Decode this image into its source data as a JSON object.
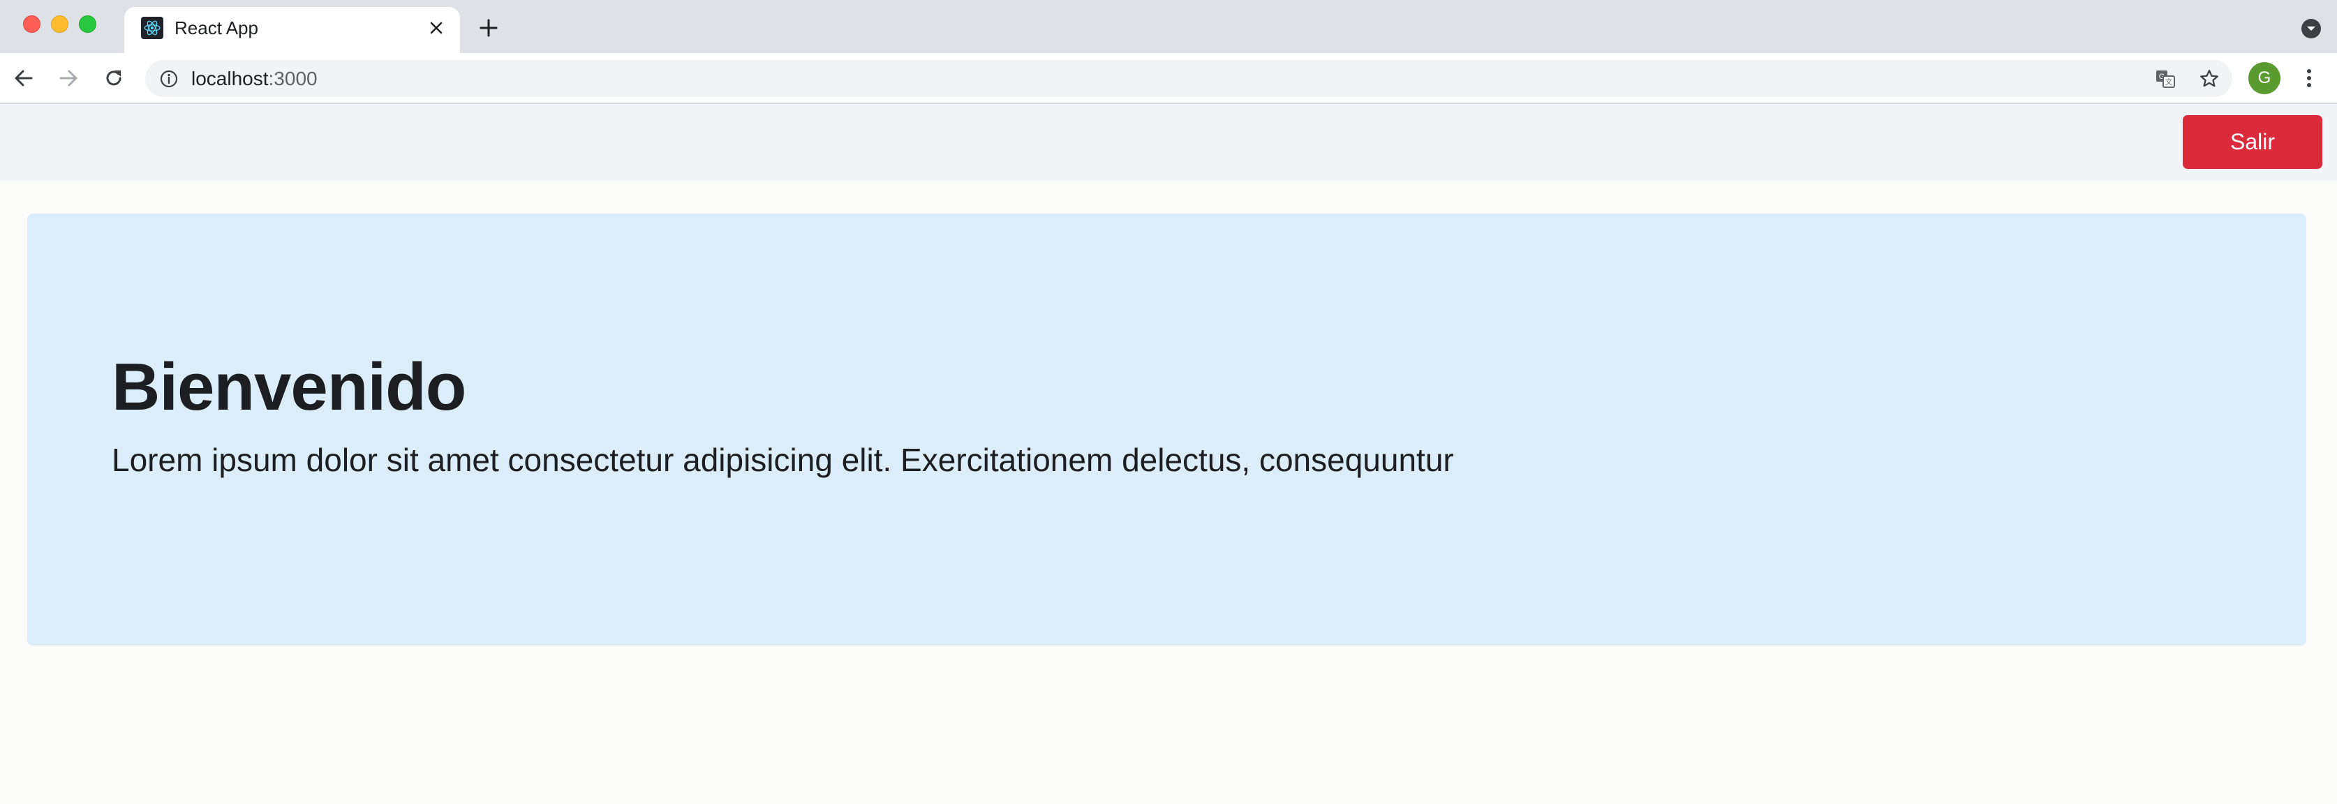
{
  "browser": {
    "tab": {
      "title": "React App",
      "favicon": "react-logo-icon"
    },
    "address_bar": {
      "host": "localhost",
      "port": ":3000"
    },
    "profile_initial": "G",
    "colors": {
      "tabstrip": "#dee1e6",
      "avatar": "#5b9a2f"
    }
  },
  "navbar": {
    "logout_label": "Salir",
    "logout_color": "#dc2a3d"
  },
  "jumbotron": {
    "title": "Bienvenido",
    "lead": "Lorem ipsum dolor sit amet consectetur adipisicing elit. Exercitationem delectus, consequuntur",
    "background": "#dbedf8"
  }
}
